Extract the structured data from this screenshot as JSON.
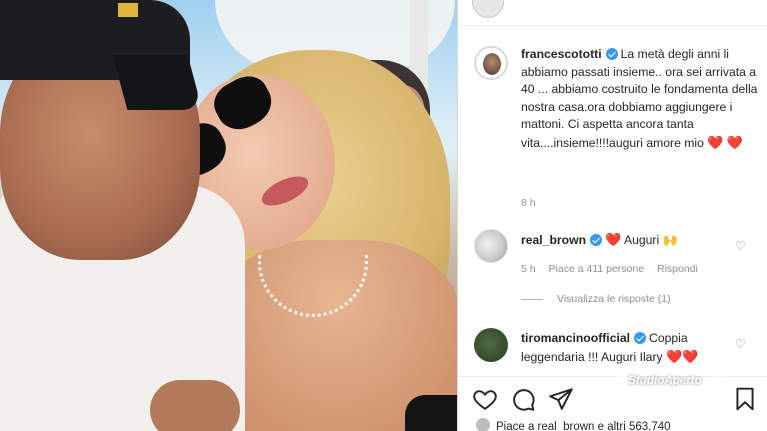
{
  "post_photo": {
    "alt": ""
  },
  "caption": {
    "username": "francescototti",
    "text": "La metà degli anni li abbiamo passati insieme.. ora sei arrivata a 40 ... abbiamo costruito le fondamenta della nostra casa.ora dobbiamo aggiungere i mattoni. Ci aspetta ancora tanta vita....insieme!!!!auguri amore mio",
    "emoji": "❤️",
    "emoji2": "❤️",
    "time": "8 h"
  },
  "comments": [
    {
      "username": "real_brown",
      "text": "Auguri",
      "emoji_before": "❤️",
      "emoji_after": "🙌",
      "time": "5 h",
      "likes": "Piace a 411 persone",
      "reply": "Rispondi",
      "view_replies": "Visualizza le risposte (1)"
    },
    {
      "username": "tiromancinoofficial",
      "text": "Coppia leggendaria !!! Auguri Ilary",
      "emoji": "❤️",
      "emoji2": "❤️"
    }
  ],
  "likes_line": "Piace a real_brown e altri 563.740",
  "watermark": "StudioAperto",
  "icons": {
    "like": "heart-outline-icon",
    "comment": "comment-bubble-icon",
    "share": "paper-plane-icon",
    "save": "bookmark-icon",
    "verified": "verified-badge-icon"
  },
  "colors": {
    "verified": "#3897f0",
    "heart": "#e0283a",
    "text": "#262626",
    "muted": "#8e8e8e"
  }
}
